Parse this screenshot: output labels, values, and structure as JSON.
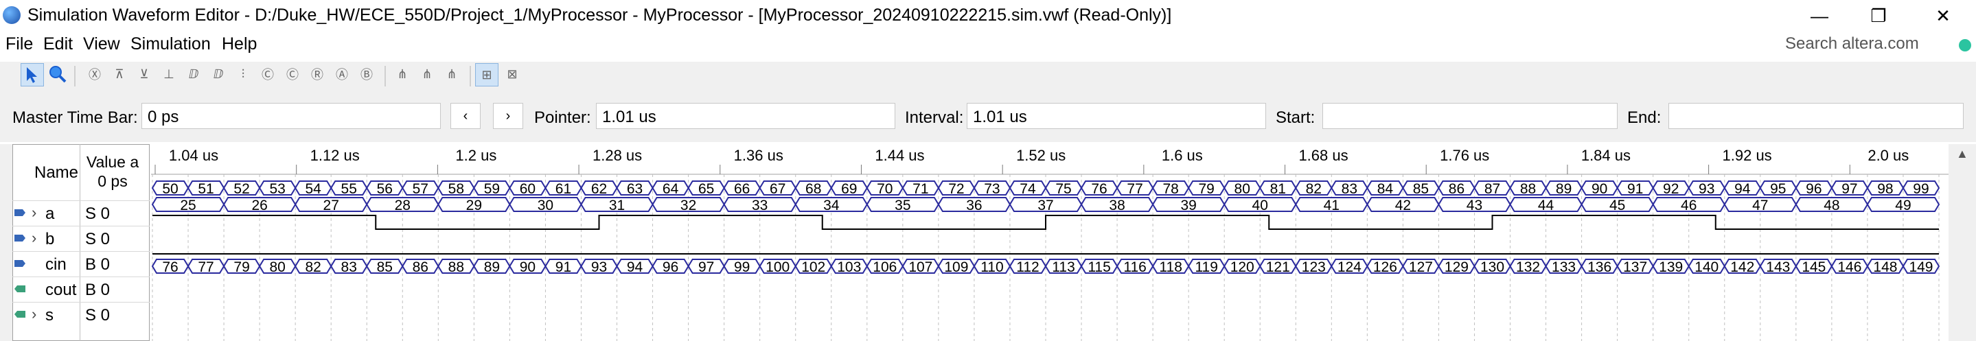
{
  "window": {
    "title": "Simulation Waveform Editor - D:/Duke_HW/ECE_550D/Project_1/MyProcessor - MyProcessor - [MyProcessor_20240910222215.sim.vwf (Read-Only)]",
    "minimize_glyph": "—",
    "maximize_glyph": "❐",
    "close_glyph": "✕"
  },
  "menu": [
    "File",
    "Edit",
    "View",
    "Simulation",
    "Help"
  ],
  "search": {
    "placeholder": "Search altera.com"
  },
  "toolbar_icons": [
    "selection-tool-icon",
    "zoom-tool-icon",
    "force-low-icon",
    "force-high-icon",
    "force-unknown-icon",
    "force-hiz-icon",
    "weak-low-icon",
    "weak-high-icon",
    "invert-icon",
    "count-value-icon",
    "clock-icon",
    "random-icon",
    "arbitrary-value-icon",
    "group-icon",
    "ungroup-icon",
    "snap-grid-icon",
    "edit-grid-icon"
  ],
  "timebar": {
    "master_label": "Master Time Bar:",
    "master_value": "0 ps",
    "prev_glyph": "‹",
    "next_glyph": "›",
    "pointer_label": "Pointer:",
    "pointer_value": "1.01 us",
    "interval_label": "Interval:",
    "interval_value": "1.01 us",
    "start_label": "Start:",
    "start_value": "",
    "end_label": "End:",
    "end_value": ""
  },
  "signal_table": {
    "name_header": "Name",
    "value_header_line1": "Value a",
    "value_header_line2": "0 ps",
    "signals": [
      {
        "name": "a",
        "value": "S 0",
        "expandable": true
      },
      {
        "name": "b",
        "value": "S 0",
        "expandable": true
      },
      {
        "name": "cin",
        "value": "B 0",
        "expandable": false
      },
      {
        "name": "cout",
        "value": "B 0",
        "expandable": false
      },
      {
        "name": "s",
        "value": "S 0",
        "expandable": true
      }
    ]
  },
  "waveform": {
    "time_ticks": [
      "1.04 us",
      "1.12 us",
      "1.2 us",
      "1.28 us",
      "1.36 us",
      "1.44 us",
      "1.52 us",
      "1.6 us",
      "1.68 us",
      "1.76 us",
      "1.84 us",
      "1.92 us",
      "2.0 us"
    ],
    "bus_a": [
      50,
      51,
      52,
      53,
      54,
      55,
      56,
      57,
      58,
      59,
      60,
      61,
      62,
      63,
      64,
      65,
      66,
      67,
      68,
      69,
      70,
      71,
      72,
      73,
      74,
      75,
      76,
      77,
      78,
      79,
      80,
      81,
      82,
      83,
      84,
      85,
      86,
      87,
      88,
      89,
      90,
      91,
      92,
      93,
      94,
      95,
      96,
      97,
      98,
      99
    ],
    "bus_b": [
      25,
      26,
      27,
      28,
      29,
      30,
      31,
      32,
      33,
      34,
      35,
      36,
      37,
      38,
      39,
      40,
      41,
      42,
      43,
      44,
      45,
      46,
      47,
      48,
      49
    ],
    "cin_levels": [
      1,
      0,
      1,
      0,
      1,
      0,
      1,
      0
    ],
    "bus_s": [
      76,
      77,
      79,
      80,
      82,
      83,
      85,
      86,
      88,
      89,
      90,
      91,
      93,
      94,
      96,
      97,
      99,
      100,
      102,
      103,
      106,
      107,
      109,
      110,
      112,
      113,
      115,
      116,
      118,
      119,
      120,
      121,
      123,
      124,
      126,
      127,
      129,
      130,
      132,
      133,
      136,
      137,
      139,
      140,
      142,
      143,
      145,
      146,
      148,
      149
    ],
    "wave_color": "#2a2a9e",
    "grid_color": "#c0c0c0"
  }
}
